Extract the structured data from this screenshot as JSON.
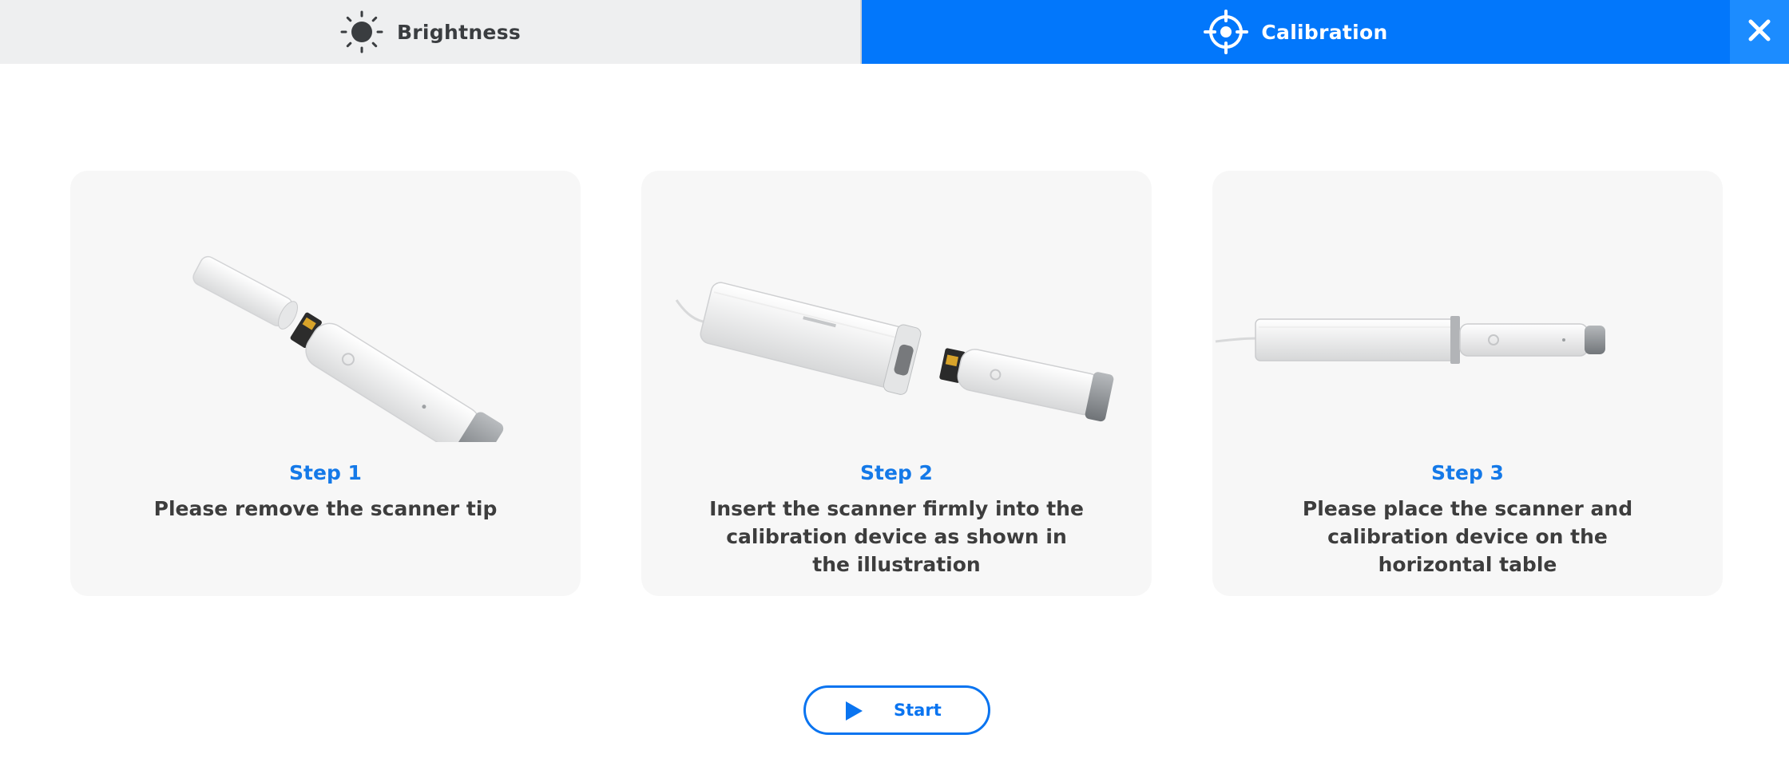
{
  "tabs": {
    "brightness": {
      "label": "Brightness",
      "icon": "sun-icon"
    },
    "calibration": {
      "label": "Calibration",
      "icon": "crosshair-icon",
      "active": true
    }
  },
  "close": {
    "icon": "close-icon"
  },
  "steps": [
    {
      "title": "Step 1",
      "description": "Please remove the scanner tip",
      "image": "scanner-tip-removed-illustration"
    },
    {
      "title": "Step 2",
      "description": "Insert the scanner firmly into the calibration device as shown in the illustration",
      "image": "scanner-calibration-device-illustration"
    },
    {
      "title": "Step 3",
      "description": "Please place the scanner and calibration device on the horizontal table",
      "image": "scanner-in-device-illustration"
    }
  ],
  "start_button": {
    "label": "Start",
    "icon": "play-icon"
  },
  "colors": {
    "accent": "#0277fb",
    "step_title": "#1479e8",
    "tab_inactive_bg": "#eeeff0",
    "card_bg": "#f7f7f7"
  }
}
